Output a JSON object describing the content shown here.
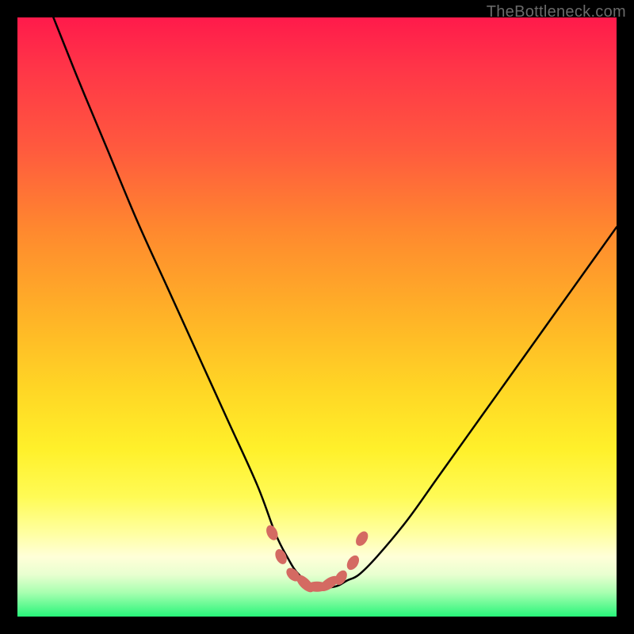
{
  "watermark": "TheBottleneck.com",
  "chart_data": {
    "type": "line",
    "title": "",
    "xlabel": "",
    "ylabel": "",
    "xlim": [
      0,
      100
    ],
    "ylim": [
      0,
      100
    ],
    "series": [
      {
        "name": "bottleneck-curve",
        "x": [
          6,
          10,
          15,
          20,
          25,
          30,
          35,
          40,
          43,
          45,
          47,
          50,
          53,
          55,
          57,
          60,
          65,
          70,
          75,
          80,
          85,
          90,
          95,
          100
        ],
        "y": [
          100,
          90,
          78,
          66,
          55,
          44,
          33,
          22,
          14,
          10,
          7,
          5,
          5,
          6,
          7,
          10,
          16,
          23,
          30,
          37,
          44,
          51,
          58,
          65
        ]
      }
    ],
    "markers": {
      "name": "highlighted-range",
      "x": [
        42.5,
        44,
        46,
        48,
        50,
        52,
        54,
        56,
        57.5
      ],
      "y": [
        14,
        10,
        7,
        5.5,
        5,
        5.5,
        6.5,
        9,
        13
      ]
    },
    "background": {
      "type": "vertical-gradient",
      "stops": [
        {
          "pos": 0,
          "color": "#ff1a4b"
        },
        {
          "pos": 50,
          "color": "#ffb327"
        },
        {
          "pos": 80,
          "color": "#fffb55"
        },
        {
          "pos": 100,
          "color": "#28f57a"
        }
      ]
    }
  }
}
